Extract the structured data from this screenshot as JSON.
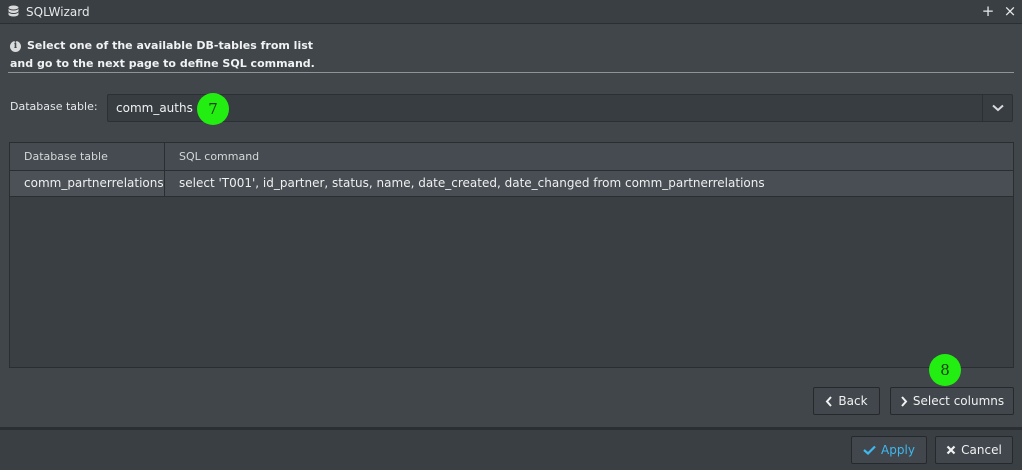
{
  "window": {
    "title": "SQLWizard",
    "controls": {
      "add": "+",
      "close": "×"
    }
  },
  "info": {
    "icon": "info-icon",
    "line1": "Select one of the available DB-tables from list",
    "line2": "and go to the next page to define SQL command."
  },
  "database_table": {
    "label": "Database table:",
    "selected": "comm_auths"
  },
  "grid": {
    "columns": [
      "Database table",
      "SQL command"
    ],
    "rows": [
      [
        "comm_partnerrelations",
        "select 'T001', id_partner, status, name, date_created, date_changed from comm_partnerrelations"
      ]
    ]
  },
  "markers": [
    "7",
    "8"
  ],
  "buttons": {
    "back": "Back",
    "select_columns": "Select columns",
    "apply": "Apply",
    "cancel": "Cancel"
  },
  "colors": {
    "accent_apply": "#3fb8f0",
    "marker": "#22ee11"
  }
}
